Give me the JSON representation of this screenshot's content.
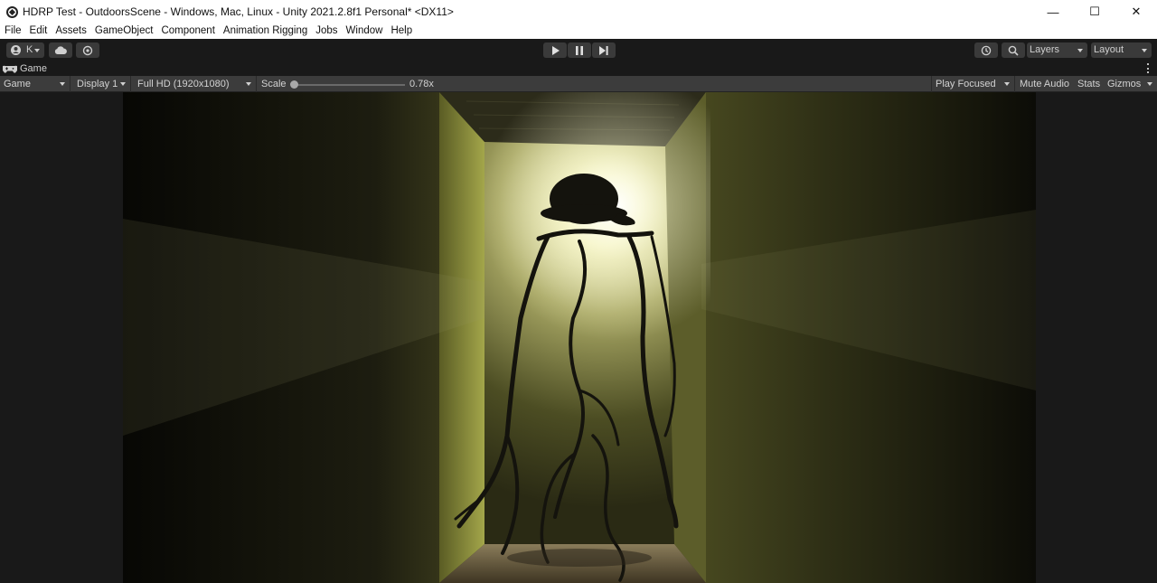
{
  "window": {
    "title": "HDRP Test - OutdoorsScene - Windows, Mac, Linux - Unity 2021.2.8f1 Personal* <DX11>",
    "controls": {
      "minimize": "—",
      "maximize": "☐",
      "close": "✕"
    }
  },
  "menu": [
    "File",
    "Edit",
    "Assets",
    "GameObject",
    "Component",
    "Animation Rigging",
    "Jobs",
    "Window",
    "Help"
  ],
  "toolbar": {
    "account_label": "K",
    "layers_label": "Layers",
    "layout_label": "Layout"
  },
  "game_tab": {
    "label": "Game"
  },
  "game_toolbar": {
    "mode": "Game",
    "display": "Display 1",
    "resolution": "Full HD (1920x1080)",
    "scale_label": "Scale",
    "scale_value": "0.78x",
    "play_focused": "Play Focused",
    "mute_audio": "Mute Audio",
    "stats": "Stats",
    "gizmos": "Gizmos"
  },
  "colors": {
    "editor_bg": "#191919",
    "toolbar_bg": "#3c3c3c",
    "corridor_light": "#f2f1c0",
    "corridor_wall": "#5c5d2a"
  }
}
